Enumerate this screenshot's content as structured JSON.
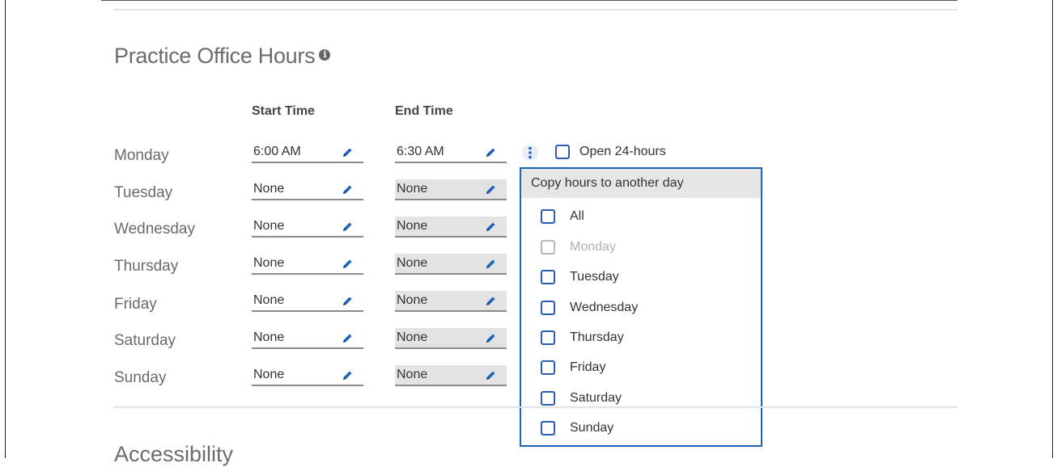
{
  "section": {
    "title": "Practice Office Hours",
    "info_icon": "info-icon"
  },
  "columns": {
    "start": "Start Time",
    "end": "End Time"
  },
  "days": [
    {
      "label": "Monday",
      "start": "6:00 AM",
      "end": "6:30 AM",
      "end_disabled": false
    },
    {
      "label": "Tuesday",
      "start": "None",
      "end": "None",
      "end_disabled": true
    },
    {
      "label": "Wednesday",
      "start": "None",
      "end": "None",
      "end_disabled": true
    },
    {
      "label": "Thursday",
      "start": "None",
      "end": "None",
      "end_disabled": true
    },
    {
      "label": "Friday",
      "start": "None",
      "end": "None",
      "end_disabled": true
    },
    {
      "label": "Saturday",
      "start": "None",
      "end": "None",
      "end_disabled": true
    },
    {
      "label": "Sunday",
      "start": "None",
      "end": "None",
      "end_disabled": true
    }
  ],
  "open24": {
    "label": "Open 24-hours",
    "checked": false
  },
  "copy_menu": {
    "header": "Copy hours to another day",
    "items": [
      {
        "label": "All",
        "disabled": false,
        "checked": false
      },
      {
        "label": "Monday",
        "disabled": true,
        "checked": false
      },
      {
        "label": "Tuesday",
        "disabled": false,
        "checked": false
      },
      {
        "label": "Wednesday",
        "disabled": false,
        "checked": false
      },
      {
        "label": "Thursday",
        "disabled": false,
        "checked": false
      },
      {
        "label": "Friday",
        "disabled": false,
        "checked": false
      },
      {
        "label": "Saturday",
        "disabled": false,
        "checked": false
      },
      {
        "label": "Sunday",
        "disabled": false,
        "checked": false
      }
    ]
  },
  "next_section": {
    "title": "Accessibility"
  },
  "colors": {
    "accent": "#1a63b5",
    "checkbox": "#2a5db0",
    "disabled_field": "#e3e3e3"
  }
}
